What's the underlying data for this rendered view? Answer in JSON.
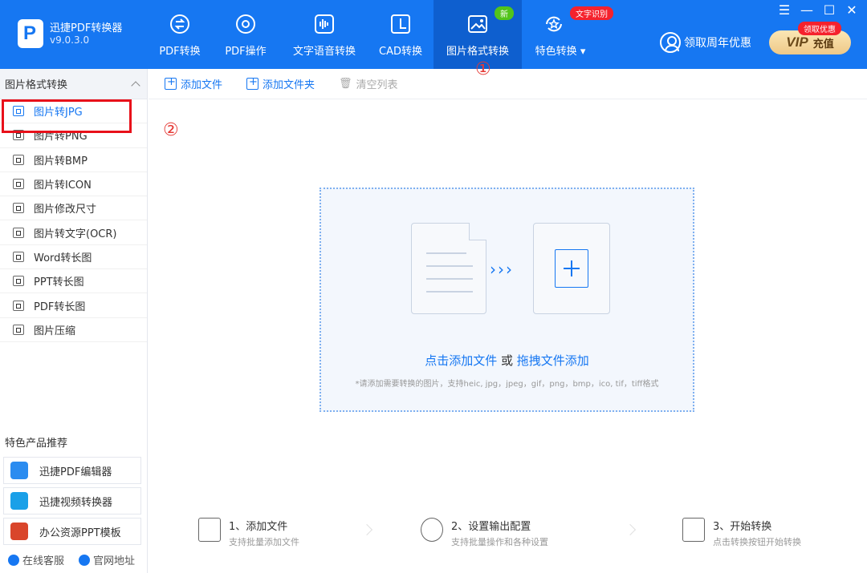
{
  "app": {
    "name": "迅捷PDF转换器",
    "version": "v9.0.3.0"
  },
  "nav": {
    "items": [
      {
        "label": "PDF转换",
        "icon": "convert-icon"
      },
      {
        "label": "PDF操作",
        "icon": "gear-circle-icon"
      },
      {
        "label": "文字语音转换",
        "icon": "audio-wave-icon"
      },
      {
        "label": "CAD转换",
        "icon": "cad-icon"
      },
      {
        "label": "图片格式转换",
        "icon": "image-icon",
        "active": true,
        "badge": "新"
      },
      {
        "label": "特色转换",
        "icon": "star-refresh-icon",
        "badge": "文字识别",
        "dropdown": true
      }
    ],
    "marker": "①"
  },
  "user": {
    "promo_link": "领取周年优惠",
    "vip_label": "VIP",
    "recharge": "充值",
    "vip_badge": "领取优惠"
  },
  "window": {
    "menu": "☰",
    "minimize": "—",
    "maximize": "☐",
    "close": "✕"
  },
  "sidebar": {
    "section": "图片格式转换",
    "items": [
      {
        "label": "图片转JPG",
        "active": true
      },
      {
        "label": "图片转PNG"
      },
      {
        "label": "图片转BMP"
      },
      {
        "label": "图片转ICON"
      },
      {
        "label": "图片修改尺寸"
      },
      {
        "label": "图片转文字(OCR)"
      },
      {
        "label": "Word转长图"
      },
      {
        "label": "PPT转长图"
      },
      {
        "label": "PDF转长图"
      },
      {
        "label": "图片压缩"
      }
    ],
    "marker": "②",
    "recommend_title": "特色产品推荐",
    "recommend": [
      {
        "label": "迅捷PDF编辑器",
        "color": "#2b8cf0"
      },
      {
        "label": "迅捷视频转换器",
        "color": "#1aa0e8"
      },
      {
        "label": "办公资源PPT模板",
        "color": "#d9452b"
      }
    ],
    "footer": {
      "support": "在线客服",
      "website": "官网地址"
    }
  },
  "toolbar": {
    "add_file": "添加文件",
    "add_folder": "添加文件夹",
    "clear_list": "清空列表"
  },
  "dropzone": {
    "click_add": "点击添加文件",
    "or": "或",
    "drag_add": "拖拽文件添加",
    "hint": "*请添加需要转换的图片，支持heic, jpg，jpeg，gif，png，bmp，ico, tif，tiff格式"
  },
  "steps": [
    {
      "title": "1、添加文件",
      "sub": "支持批量添加文件"
    },
    {
      "title": "2、设置输出配置",
      "sub": "支持批量操作和各种设置"
    },
    {
      "title": "3、开始转换",
      "sub": "点击转换按钮开始转换"
    }
  ],
  "colors": {
    "brand": "#1677f2",
    "active_nav": "#0e5fcf",
    "annotation_red": "#e8101a",
    "badge_green": "#52c41a",
    "badge_red": "#f5222d"
  }
}
